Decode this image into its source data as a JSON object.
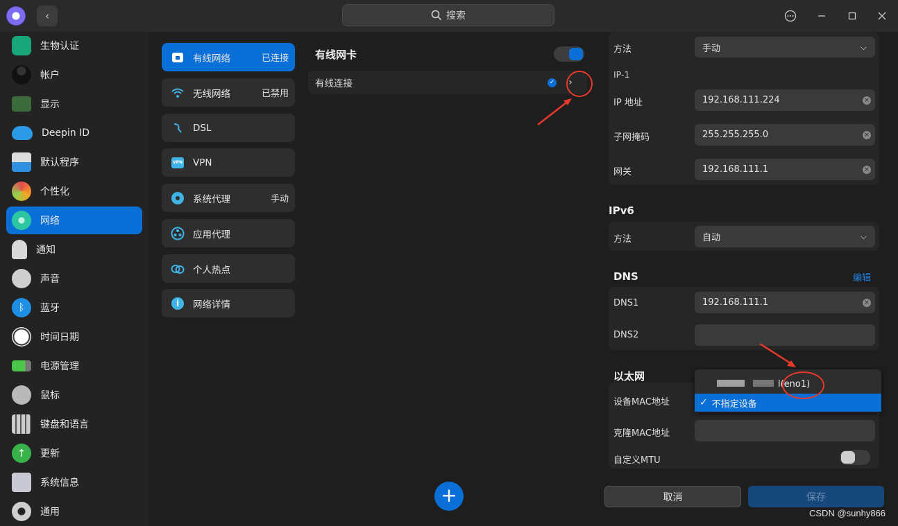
{
  "titlebar": {
    "search_placeholder": "搜索"
  },
  "nav": {
    "items": [
      {
        "label": "生物认证",
        "icon": "fingerprint-icon"
      },
      {
        "label": "帐户",
        "icon": "account-icon"
      },
      {
        "label": "显示",
        "icon": "display-icon"
      },
      {
        "label": "Deepin ID",
        "icon": "cloud-icon"
      },
      {
        "label": "默认程序",
        "icon": "default-apps-icon"
      },
      {
        "label": "个性化",
        "icon": "personalization-icon"
      },
      {
        "label": "网络",
        "icon": "network-icon",
        "active": true
      },
      {
        "label": "通知",
        "icon": "bell-icon"
      },
      {
        "label": "声音",
        "icon": "speaker-icon"
      },
      {
        "label": "蓝牙",
        "icon": "bluetooth-icon"
      },
      {
        "label": "时间日期",
        "icon": "clock-icon"
      },
      {
        "label": "电源管理",
        "icon": "battery-icon"
      },
      {
        "label": "鼠标",
        "icon": "mouse-icon"
      },
      {
        "label": "键盘和语言",
        "icon": "keyboard-icon"
      },
      {
        "label": "更新",
        "icon": "update-icon"
      },
      {
        "label": "系统信息",
        "icon": "system-info-icon"
      },
      {
        "label": "通用",
        "icon": "general-icon"
      }
    ]
  },
  "network_menu": {
    "items": [
      {
        "label": "有线网络",
        "status": "已连接",
        "icon": "wired-network-icon",
        "active": true
      },
      {
        "label": "无线网络",
        "status": "已禁用",
        "icon": "wifi-icon"
      },
      {
        "label": "DSL",
        "status": "",
        "icon": "dsl-icon"
      },
      {
        "label": "VPN",
        "status": "",
        "icon": "vpn-icon"
      },
      {
        "label": "系统代理",
        "status": "手动",
        "icon": "proxy-icon"
      },
      {
        "label": "应用代理",
        "status": "",
        "icon": "app-proxy-icon"
      },
      {
        "label": "个人热点",
        "status": "",
        "icon": "hotspot-icon"
      },
      {
        "label": "网络详情",
        "status": "",
        "icon": "info-icon"
      }
    ]
  },
  "wired": {
    "card_title": "有线网卡",
    "enabled": true,
    "connection_label": "有线连接"
  },
  "settings": {
    "ipv4_method_label": "方法",
    "ipv4_method_value": "手动",
    "ip_group_label": "IP-1",
    "ip_label": "IP 地址",
    "ip_value": "192.168.111.224",
    "mask_label": "子网掩码",
    "mask_value": "255.255.255.0",
    "gateway_label": "网关",
    "gateway_value": "192.168.111.1",
    "ipv6_title": "IPv6",
    "ipv6_method_label": "方法",
    "ipv6_method_value": "自动",
    "dns_title": "DNS",
    "dns_edit": "编辑",
    "dns1_label": "DNS1",
    "dns1_value": "192.168.111.1",
    "dns2_label": "DNS2",
    "dns2_value": "",
    "ethernet_title": "以太网",
    "device_mac_label": "设备MAC地址",
    "clone_mac_label": "克隆MAC地址",
    "clone_mac_value": "",
    "mtu_label": "自定义MTU",
    "mtu_enabled": false
  },
  "mac_dropdown": {
    "options": [
      {
        "label": "l(eno1)"
      },
      {
        "label": "不指定设备",
        "selected": true
      }
    ]
  },
  "buttons": {
    "cancel": "取消",
    "save": "保存"
  },
  "watermark": "CSDN @sunhy866",
  "colors": {
    "accent": "#0a6fd6",
    "annotation": "#e8382b"
  }
}
